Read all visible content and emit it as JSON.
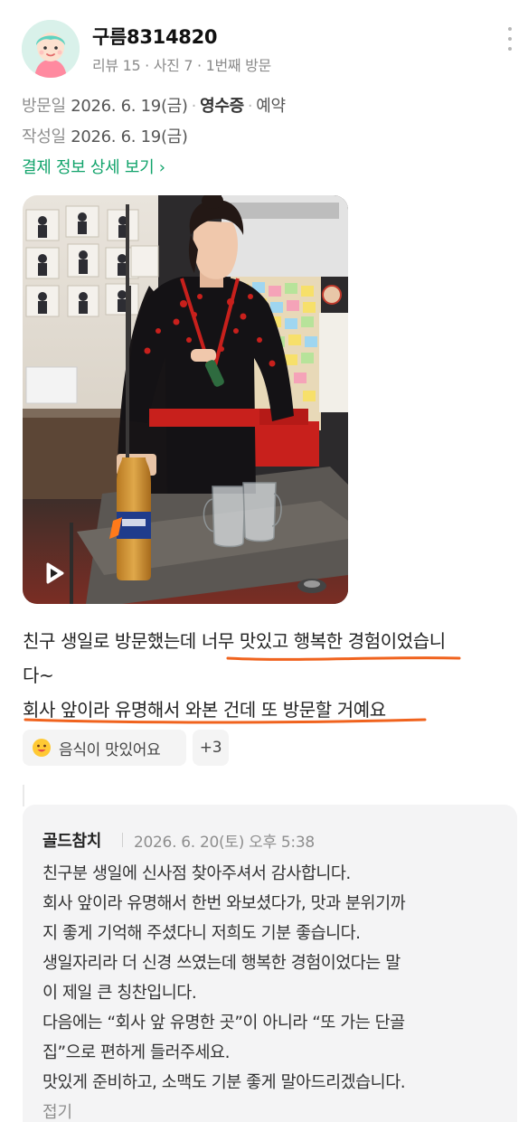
{
  "user": {
    "nickname": "구름8314820",
    "stats": "리뷰 15 · 사진 7 · 1번째 방문"
  },
  "visit": {
    "label": "방문일",
    "date": "2026. 6. 19(금)",
    "receipt": "영수증",
    "reservation": "예약"
  },
  "written": {
    "label": "작성일",
    "date": "2026. 6. 19(금)"
  },
  "payment_link": "결제 정보 상세 보기 ›",
  "photo": {
    "media_type": "video",
    "icon": "play-icon"
  },
  "review": {
    "lines": [
      "친구 생일로 방문했는데 너무 맛있고 행복한 경험이었습니",
      "다~",
      "회사 앞이라 유명해서 와본 건데 또 방문할 거예요"
    ],
    "highlight_color": "#f0631e"
  },
  "tags": {
    "food": "음식이 맛있어요",
    "food_icon": "smiley-icon",
    "more": "+3"
  },
  "reply": {
    "owner": "골드참치",
    "date": "2026. 6. 20(토) 오후 5:38",
    "lines": [
      "친구분 생일에 신사점 찾아주셔서 감사합니다.",
      "회사 앞이라 유명해서 한번 와보셨다가, 맛과 분위기까",
      "지 좋게 기억해 주셨다니 저희도 기분 좋습니다.",
      "생일자리라 더 신경 쓰였는데 행복한 경험이었다는 말",
      "이 제일 큰 칭찬입니다.",
      "다음에는 “회사 앞 유명한 곳”이 아니라 “또 가는 단골",
      "집”으로 편하게 들러주세요.",
      "맛있게 준비하고, 소맥도 기분 좋게 말아드리겠습니다."
    ],
    "fold": "접기"
  },
  "colors": {
    "accent_green": "#10a36a",
    "underline_orange": "#f0631e",
    "reply_bg": "#f4f4f5"
  }
}
